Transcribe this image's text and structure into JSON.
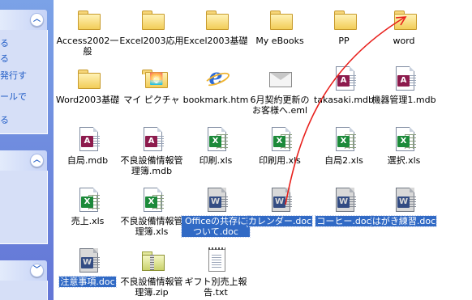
{
  "task_pane": {
    "sections": [
      {
        "links": [
          "る",
          "る",
          "発行す",
          "ールで",
          "る"
        ],
        "collapse_glyph": "︿"
      },
      {
        "links": [],
        "collapse_glyph": "︿"
      },
      {
        "links": [],
        "collapse_glyph": "﹀"
      }
    ]
  },
  "files": [
    {
      "label": "Access2002一般",
      "type": "folder",
      "selected": false
    },
    {
      "label": "Excel2003応用",
      "type": "folder",
      "selected": false
    },
    {
      "label": "Excel2003基礎",
      "type": "folder",
      "selected": false
    },
    {
      "label": "My eBooks",
      "type": "folder",
      "selected": false
    },
    {
      "label": "PP",
      "type": "folder",
      "selected": false
    },
    {
      "label": "word",
      "type": "folder",
      "selected": false
    },
    {
      "label": "Word2003基礎",
      "type": "folder",
      "selected": false
    },
    {
      "label": "マイ ピクチャ",
      "type": "pictures-folder",
      "selected": false
    },
    {
      "label": "bookmark.htm",
      "type": "ie-file",
      "selected": false
    },
    {
      "label": "6月契約更新のお客様へ.eml",
      "type": "email-file",
      "selected": false
    },
    {
      "label": "takasaki.mdb",
      "type": "access-file",
      "selected": false
    },
    {
      "label": "機器管理1.mdb",
      "type": "access-file",
      "selected": false
    },
    {
      "label": "自局.mdb",
      "type": "access-file",
      "selected": false
    },
    {
      "label": "不良設備情報管理簿.mdb",
      "type": "access-file",
      "selected": false
    },
    {
      "label": "印刷.xls",
      "type": "excel-file",
      "selected": false
    },
    {
      "label": "印刷用.xls",
      "type": "excel-file",
      "selected": false
    },
    {
      "label": "自局2.xls",
      "type": "excel-file",
      "selected": false
    },
    {
      "label": "選択.xls",
      "type": "excel-file",
      "selected": false
    },
    {
      "label": "売上.xls",
      "type": "excel-file",
      "selected": false
    },
    {
      "label": "不良設備情報管理簿.xls",
      "type": "excel-file",
      "selected": false
    },
    {
      "label": "Officeの共存について.doc",
      "type": "word-file",
      "selected": true
    },
    {
      "label": "カレンダー.doc",
      "type": "word-file",
      "selected": true
    },
    {
      "label": "コーヒー.doc",
      "type": "word-file",
      "selected": true
    },
    {
      "label": "はがき練習.doc",
      "type": "word-file",
      "selected": true
    },
    {
      "label": "注意事項.doc",
      "type": "word-file",
      "selected": true
    },
    {
      "label": "不良設備情報管理簿.zip",
      "type": "zip-file",
      "selected": false
    },
    {
      "label": "ギフト別売上報告.txt",
      "type": "text-file",
      "selected": false
    }
  ],
  "colors": {
    "selection": "#316ac5",
    "arrow": "#e8201c",
    "task_pane_link": "#215dc6"
  }
}
